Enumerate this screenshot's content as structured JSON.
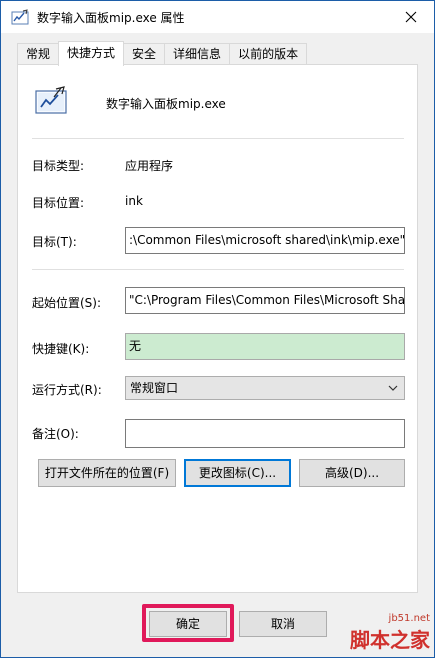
{
  "window": {
    "title": "数字输入面板mip.exe  属性",
    "close_icon": "close-icon"
  },
  "tabs": [
    {
      "label": "常规",
      "active": false
    },
    {
      "label": "快捷方式",
      "active": true
    },
    {
      "label": "安全",
      "active": false
    },
    {
      "label": "详细信息",
      "active": false
    },
    {
      "label": "以前的版本",
      "active": false
    }
  ],
  "shortcut": {
    "app_name": "数字输入面板mip.exe",
    "target_type_label": "目标类型:",
    "target_type_value": "应用程序",
    "target_location_label": "目标位置:",
    "target_location_value": "ink",
    "target_label": "目标(T):",
    "target_value": "C:\\Program Files\\Common Files\\microsoft shared\\ink\\mip.exe\"",
    "target_visible": ":\\Common Files\\microsoft shared\\ink\\mip.exe\"",
    "start_in_label": "起始位置(S):",
    "start_in_value": "\"C:\\Program Files\\Common Files\\Microsoft Sha",
    "hotkey_label": "快捷键(K):",
    "hotkey_value": "无",
    "run_label": "运行方式(R):",
    "run_value": "常规窗口",
    "comment_label": "备注(O):",
    "comment_value": "",
    "open_location_button": "打开文件所在的位置(F)",
    "change_icon_button": "更改图标(C)...",
    "advanced_button": "高级(D)..."
  },
  "footer": {
    "ok_button": "确定",
    "cancel_button": "取消"
  },
  "watermark": {
    "site": "jb51.net",
    "name": "脚本之家"
  },
  "colors": {
    "highlight": "#e0195a",
    "hotkey_bg": "#ccebd0",
    "focus": "#0078d7"
  }
}
